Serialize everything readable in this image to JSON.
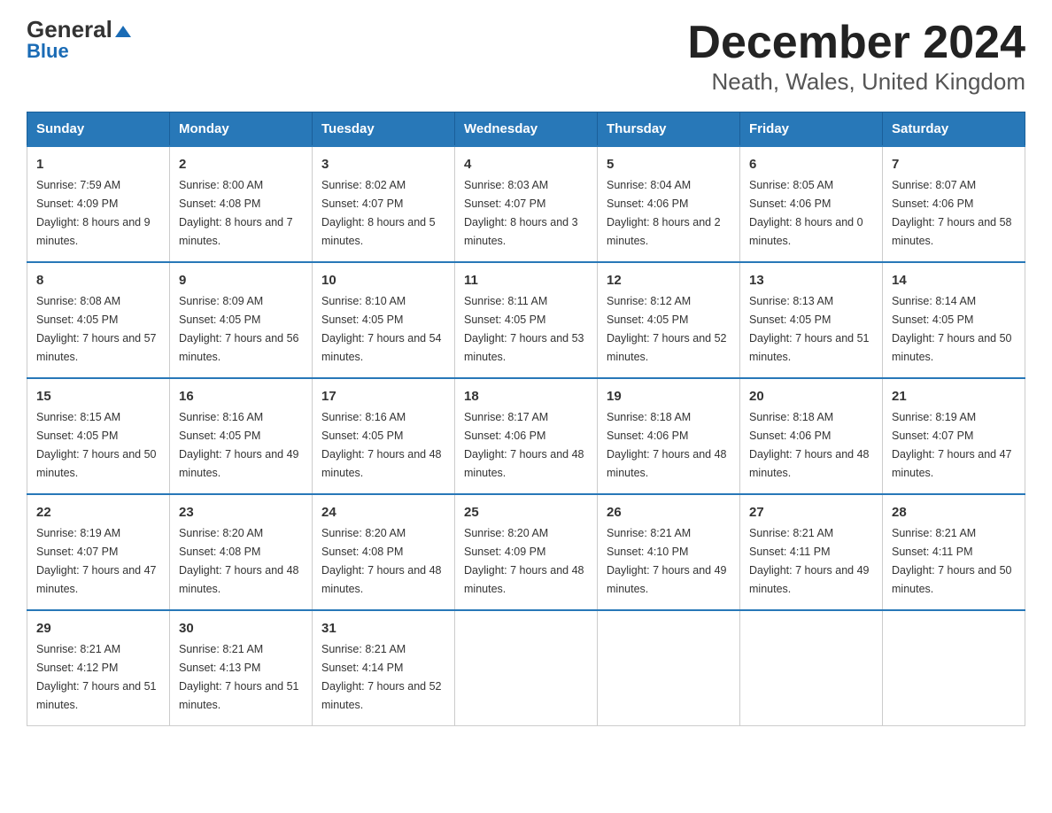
{
  "logo": {
    "line1": "General",
    "line2": "Blue"
  },
  "title": "December 2024",
  "subtitle": "Neath, Wales, United Kingdom",
  "weekdays": [
    "Sunday",
    "Monday",
    "Tuesday",
    "Wednesday",
    "Thursday",
    "Friday",
    "Saturday"
  ],
  "weeks": [
    [
      {
        "day": "1",
        "sunrise": "7:59 AM",
        "sunset": "4:09 PM",
        "daylight": "8 hours and 9 minutes."
      },
      {
        "day": "2",
        "sunrise": "8:00 AM",
        "sunset": "4:08 PM",
        "daylight": "8 hours and 7 minutes."
      },
      {
        "day": "3",
        "sunrise": "8:02 AM",
        "sunset": "4:07 PM",
        "daylight": "8 hours and 5 minutes."
      },
      {
        "day": "4",
        "sunrise": "8:03 AM",
        "sunset": "4:07 PM",
        "daylight": "8 hours and 3 minutes."
      },
      {
        "day": "5",
        "sunrise": "8:04 AM",
        "sunset": "4:06 PM",
        "daylight": "8 hours and 2 minutes."
      },
      {
        "day": "6",
        "sunrise": "8:05 AM",
        "sunset": "4:06 PM",
        "daylight": "8 hours and 0 minutes."
      },
      {
        "day": "7",
        "sunrise": "8:07 AM",
        "sunset": "4:06 PM",
        "daylight": "7 hours and 58 minutes."
      }
    ],
    [
      {
        "day": "8",
        "sunrise": "8:08 AM",
        "sunset": "4:05 PM",
        "daylight": "7 hours and 57 minutes."
      },
      {
        "day": "9",
        "sunrise": "8:09 AM",
        "sunset": "4:05 PM",
        "daylight": "7 hours and 56 minutes."
      },
      {
        "day": "10",
        "sunrise": "8:10 AM",
        "sunset": "4:05 PM",
        "daylight": "7 hours and 54 minutes."
      },
      {
        "day": "11",
        "sunrise": "8:11 AM",
        "sunset": "4:05 PM",
        "daylight": "7 hours and 53 minutes."
      },
      {
        "day": "12",
        "sunrise": "8:12 AM",
        "sunset": "4:05 PM",
        "daylight": "7 hours and 52 minutes."
      },
      {
        "day": "13",
        "sunrise": "8:13 AM",
        "sunset": "4:05 PM",
        "daylight": "7 hours and 51 minutes."
      },
      {
        "day": "14",
        "sunrise": "8:14 AM",
        "sunset": "4:05 PM",
        "daylight": "7 hours and 50 minutes."
      }
    ],
    [
      {
        "day": "15",
        "sunrise": "8:15 AM",
        "sunset": "4:05 PM",
        "daylight": "7 hours and 50 minutes."
      },
      {
        "day": "16",
        "sunrise": "8:16 AM",
        "sunset": "4:05 PM",
        "daylight": "7 hours and 49 minutes."
      },
      {
        "day": "17",
        "sunrise": "8:16 AM",
        "sunset": "4:05 PM",
        "daylight": "7 hours and 48 minutes."
      },
      {
        "day": "18",
        "sunrise": "8:17 AM",
        "sunset": "4:06 PM",
        "daylight": "7 hours and 48 minutes."
      },
      {
        "day": "19",
        "sunrise": "8:18 AM",
        "sunset": "4:06 PM",
        "daylight": "7 hours and 48 minutes."
      },
      {
        "day": "20",
        "sunrise": "8:18 AM",
        "sunset": "4:06 PM",
        "daylight": "7 hours and 48 minutes."
      },
      {
        "day": "21",
        "sunrise": "8:19 AM",
        "sunset": "4:07 PM",
        "daylight": "7 hours and 47 minutes."
      }
    ],
    [
      {
        "day": "22",
        "sunrise": "8:19 AM",
        "sunset": "4:07 PM",
        "daylight": "7 hours and 47 minutes."
      },
      {
        "day": "23",
        "sunrise": "8:20 AM",
        "sunset": "4:08 PM",
        "daylight": "7 hours and 48 minutes."
      },
      {
        "day": "24",
        "sunrise": "8:20 AM",
        "sunset": "4:08 PM",
        "daylight": "7 hours and 48 minutes."
      },
      {
        "day": "25",
        "sunrise": "8:20 AM",
        "sunset": "4:09 PM",
        "daylight": "7 hours and 48 minutes."
      },
      {
        "day": "26",
        "sunrise": "8:21 AM",
        "sunset": "4:10 PM",
        "daylight": "7 hours and 49 minutes."
      },
      {
        "day": "27",
        "sunrise": "8:21 AM",
        "sunset": "4:11 PM",
        "daylight": "7 hours and 49 minutes."
      },
      {
        "day": "28",
        "sunrise": "8:21 AM",
        "sunset": "4:11 PM",
        "daylight": "7 hours and 50 minutes."
      }
    ],
    [
      {
        "day": "29",
        "sunrise": "8:21 AM",
        "sunset": "4:12 PM",
        "daylight": "7 hours and 51 minutes."
      },
      {
        "day": "30",
        "sunrise": "8:21 AM",
        "sunset": "4:13 PM",
        "daylight": "7 hours and 51 minutes."
      },
      {
        "day": "31",
        "sunrise": "8:21 AM",
        "sunset": "4:14 PM",
        "daylight": "7 hours and 52 minutes."
      },
      null,
      null,
      null,
      null
    ]
  ],
  "labels": {
    "sunrise": "Sunrise:",
    "sunset": "Sunset:",
    "daylight": "Daylight:"
  }
}
